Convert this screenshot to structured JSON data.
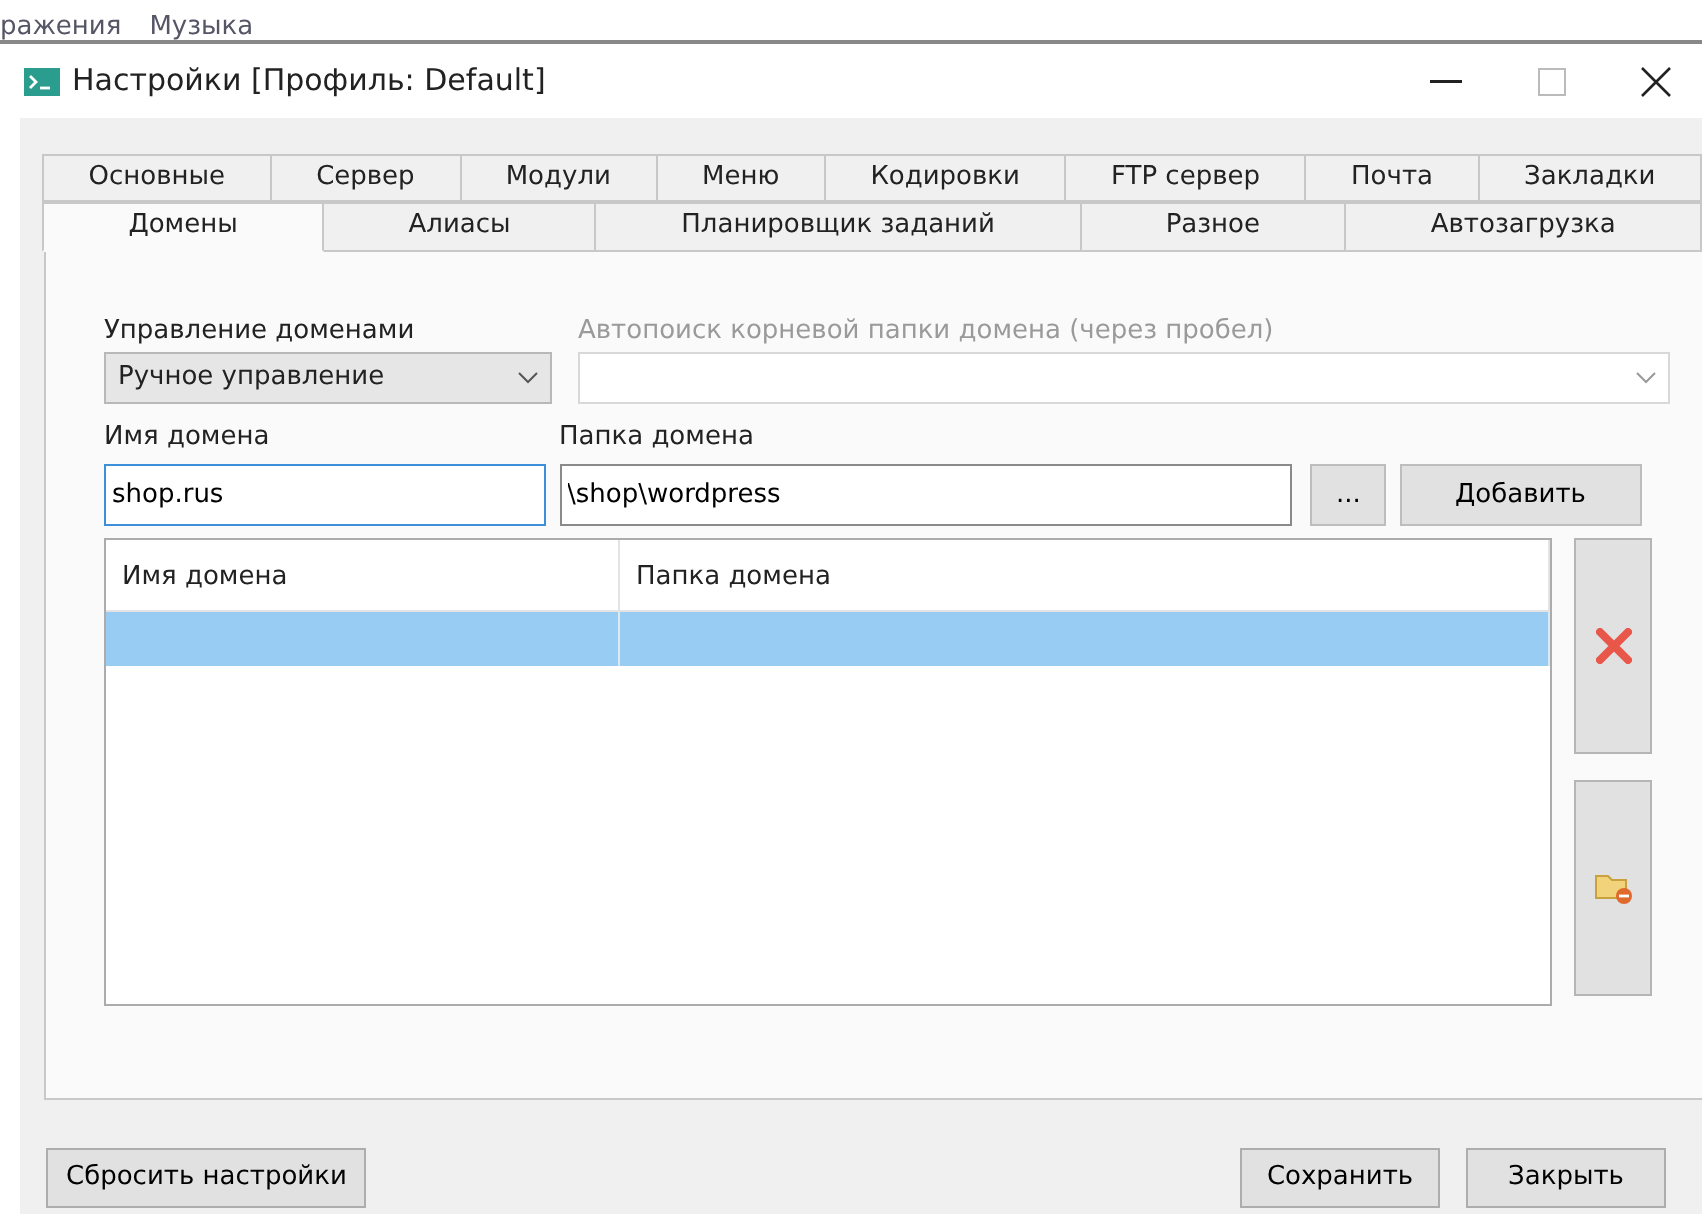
{
  "background_window": {
    "items": [
      "ражения",
      "Музыка"
    ]
  },
  "window": {
    "title": "Настройки [Профиль: Default]",
    "maximize_disabled": true
  },
  "tab_rows": [
    {
      "tabs": [
        {
          "label": "Основные",
          "selected": false
        },
        {
          "label": "Сервер",
          "selected": false
        },
        {
          "label": "Модули",
          "selected": false
        },
        {
          "label": "Меню",
          "selected": false
        },
        {
          "label": "Кодировки",
          "selected": false
        },
        {
          "label": "FTP сервер",
          "selected": false
        },
        {
          "label": "Почта",
          "selected": false
        },
        {
          "label": "Закладки",
          "selected": false
        }
      ]
    },
    {
      "tabs": [
        {
          "label": "Домены",
          "selected": true
        },
        {
          "label": "Алиасы",
          "selected": false
        },
        {
          "label": "Планировщик заданий",
          "selected": false
        },
        {
          "label": "Разное",
          "selected": false
        },
        {
          "label": "Автозагрузка",
          "selected": false
        }
      ]
    }
  ],
  "domain_management": {
    "label": "Управление доменами",
    "value": "Ручное управление",
    "disabled": false
  },
  "autosearch": {
    "label": "Автопоиск корневой папки домена (через пробел)",
    "disabled": true
  },
  "domain_name": {
    "label": "Имя домена",
    "value": "shop.rus",
    "focused": true
  },
  "domain_folder": {
    "label": "Папка домена",
    "value": "\\shop\\wordpress",
    "focused": false
  },
  "browse_button": "...",
  "add_button": "Добавить",
  "table": {
    "columns": [
      "Имя домена",
      "Папка домена"
    ],
    "rows": [
      {
        "selected": true
      }
    ]
  },
  "footer_buttons": [
    {
      "label": "Сбросить настройки",
      "kind": "left"
    },
    {
      "label": "Сохранить",
      "kind": "right"
    },
    {
      "label": "Закрыть",
      "kind": "right"
    }
  ]
}
